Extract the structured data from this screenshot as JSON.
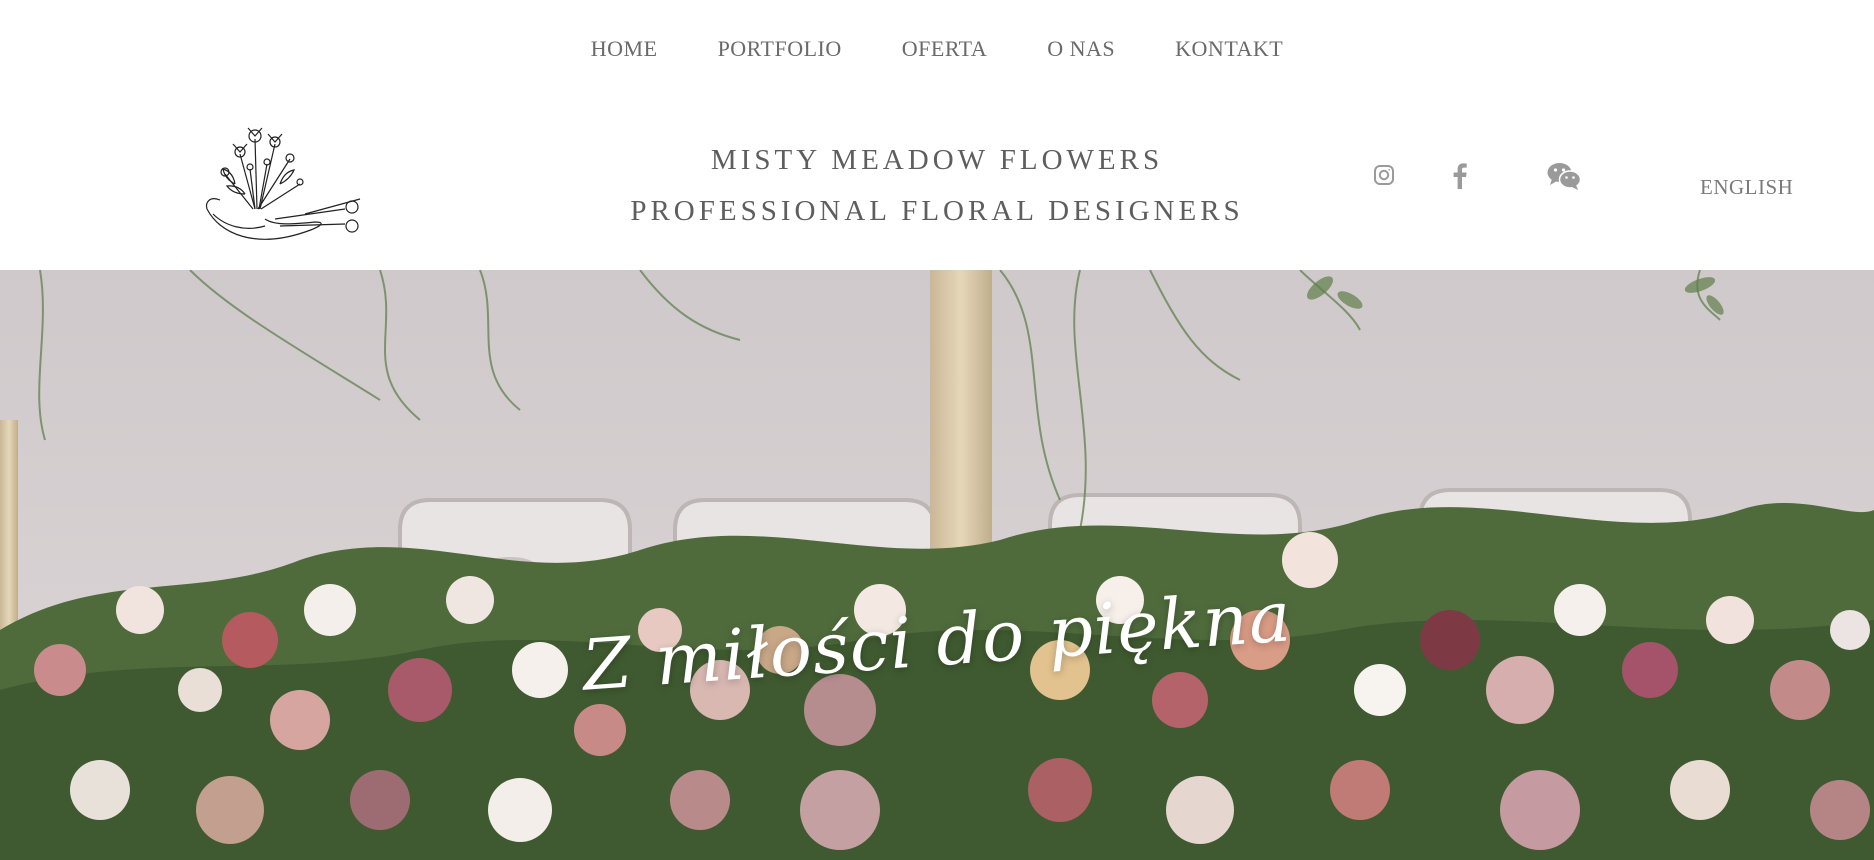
{
  "nav": {
    "items": [
      "HOME",
      "PORTFOLIO",
      "OFERTA",
      "O NAS",
      "KONTAKT"
    ]
  },
  "header": {
    "brand_line1": "MISTY MEADOW FLOWERS",
    "brand_line2": "PROFESSIONAL FLORAL DESIGNERS",
    "logo_icon": "hand-bouquet-scissors-sketch",
    "social_icons": [
      "instagram-icon",
      "facebook-icon",
      "wechat-icon"
    ],
    "language_link": "ENGLISH"
  },
  "hero": {
    "tagline": "Z miłości do piękna",
    "image_description_icon": "floral-table-arrangement-photo"
  },
  "colors": {
    "text": "#5e5e5e",
    "icon": "#9a9a9a",
    "hero_wall": "#d7d1d3",
    "white": "#ffffff"
  }
}
